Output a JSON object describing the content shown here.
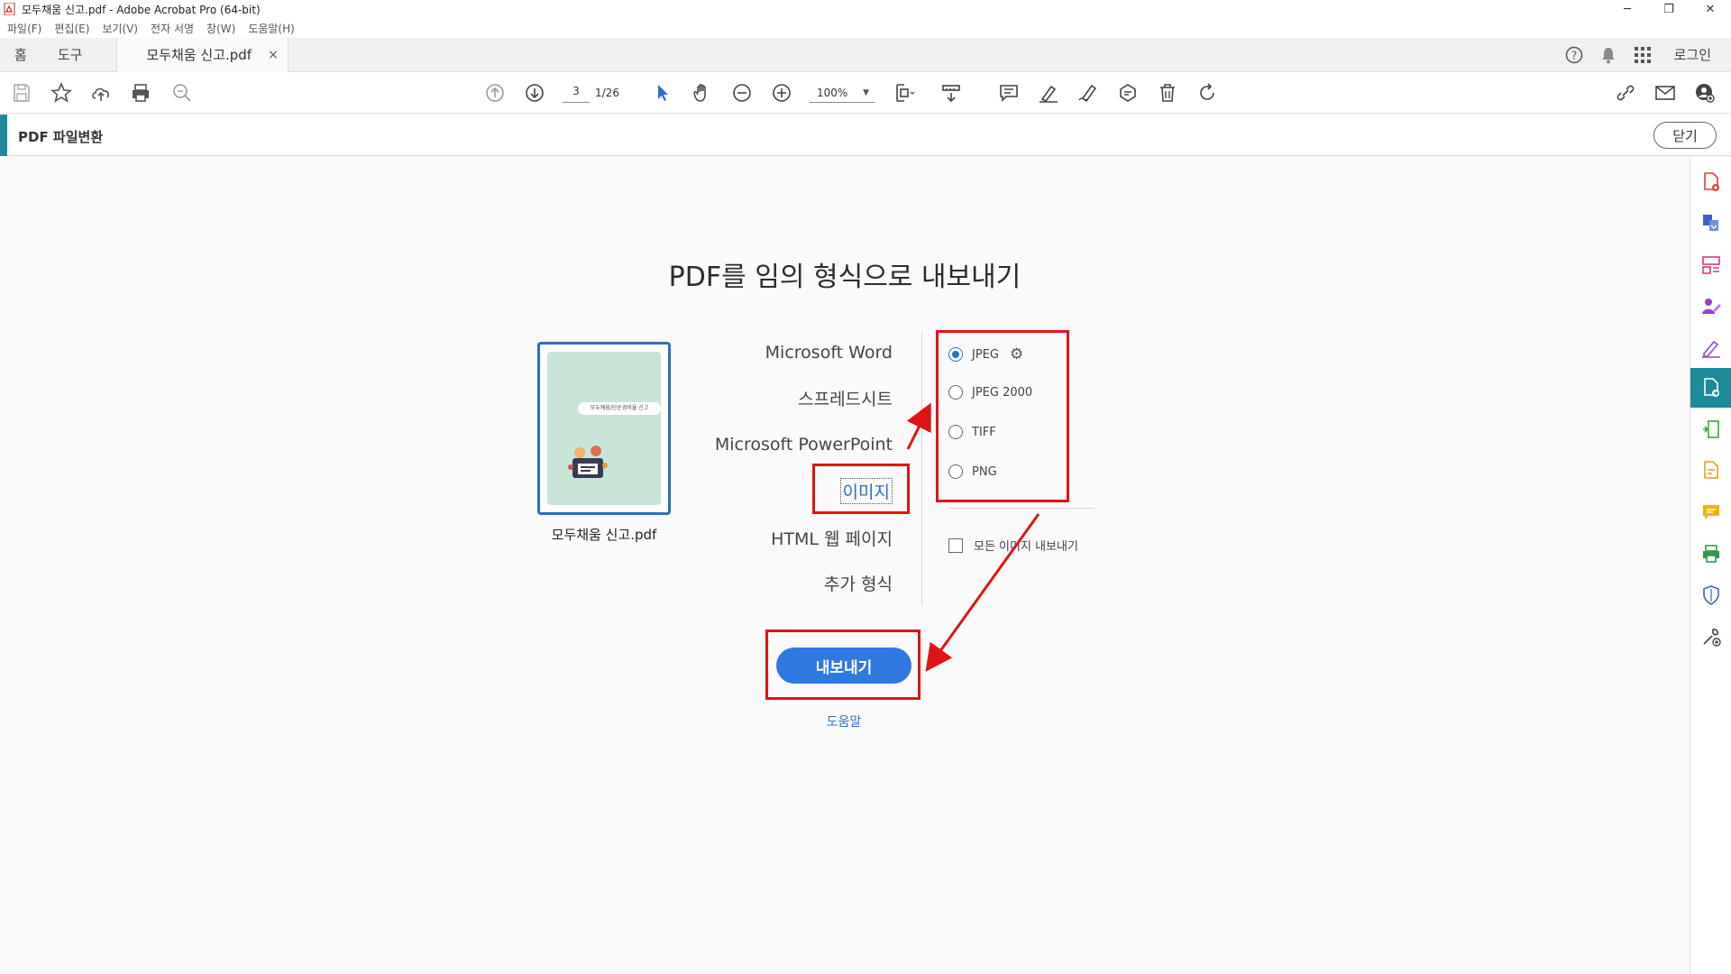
{
  "window": {
    "title": "모두채움 신고.pdf - Adobe Acrobat Pro (64-bit)",
    "minimize": "─",
    "restore": "❐",
    "close": "✕"
  },
  "menu": [
    "파일(F)",
    "편집(E)",
    "보기(V)",
    "전자 서명",
    "창(W)",
    "도움말(H)"
  ],
  "tabs": {
    "home": "홈",
    "tools": "도구",
    "document": "모두채움 신고.pdf",
    "close_glyph": "×",
    "login": "로그인"
  },
  "toolbar": {
    "page_current": "3",
    "page_total": "1/26",
    "zoom": "100%"
  },
  "conversion": {
    "label": "PDF 파일변환",
    "close_label": "닫기"
  },
  "main": {
    "heading": "PDF를 임의 형식으로 내보내기",
    "file_name": "모두채움 신고.pdf",
    "thumbnail_pill": "모두채움/단순경비율 신고",
    "formats": [
      "Microsoft Word",
      "스프레드시트",
      "Microsoft PowerPoint",
      "이미지",
      "HTML 웹 페이지",
      "추가 형식"
    ],
    "selected_format": "이미지",
    "image_options": [
      "JPEG",
      "JPEG 2000",
      "TIFF",
      "PNG"
    ],
    "selected_option": "JPEG",
    "export_all_images": "모든 이미지 내보내기",
    "export_button": "내보내기",
    "help": "도움말"
  },
  "colors": {
    "accent_teal": "#1c8a9b",
    "primary_blue": "#2f78e0",
    "annotation_red": "#e01414"
  }
}
